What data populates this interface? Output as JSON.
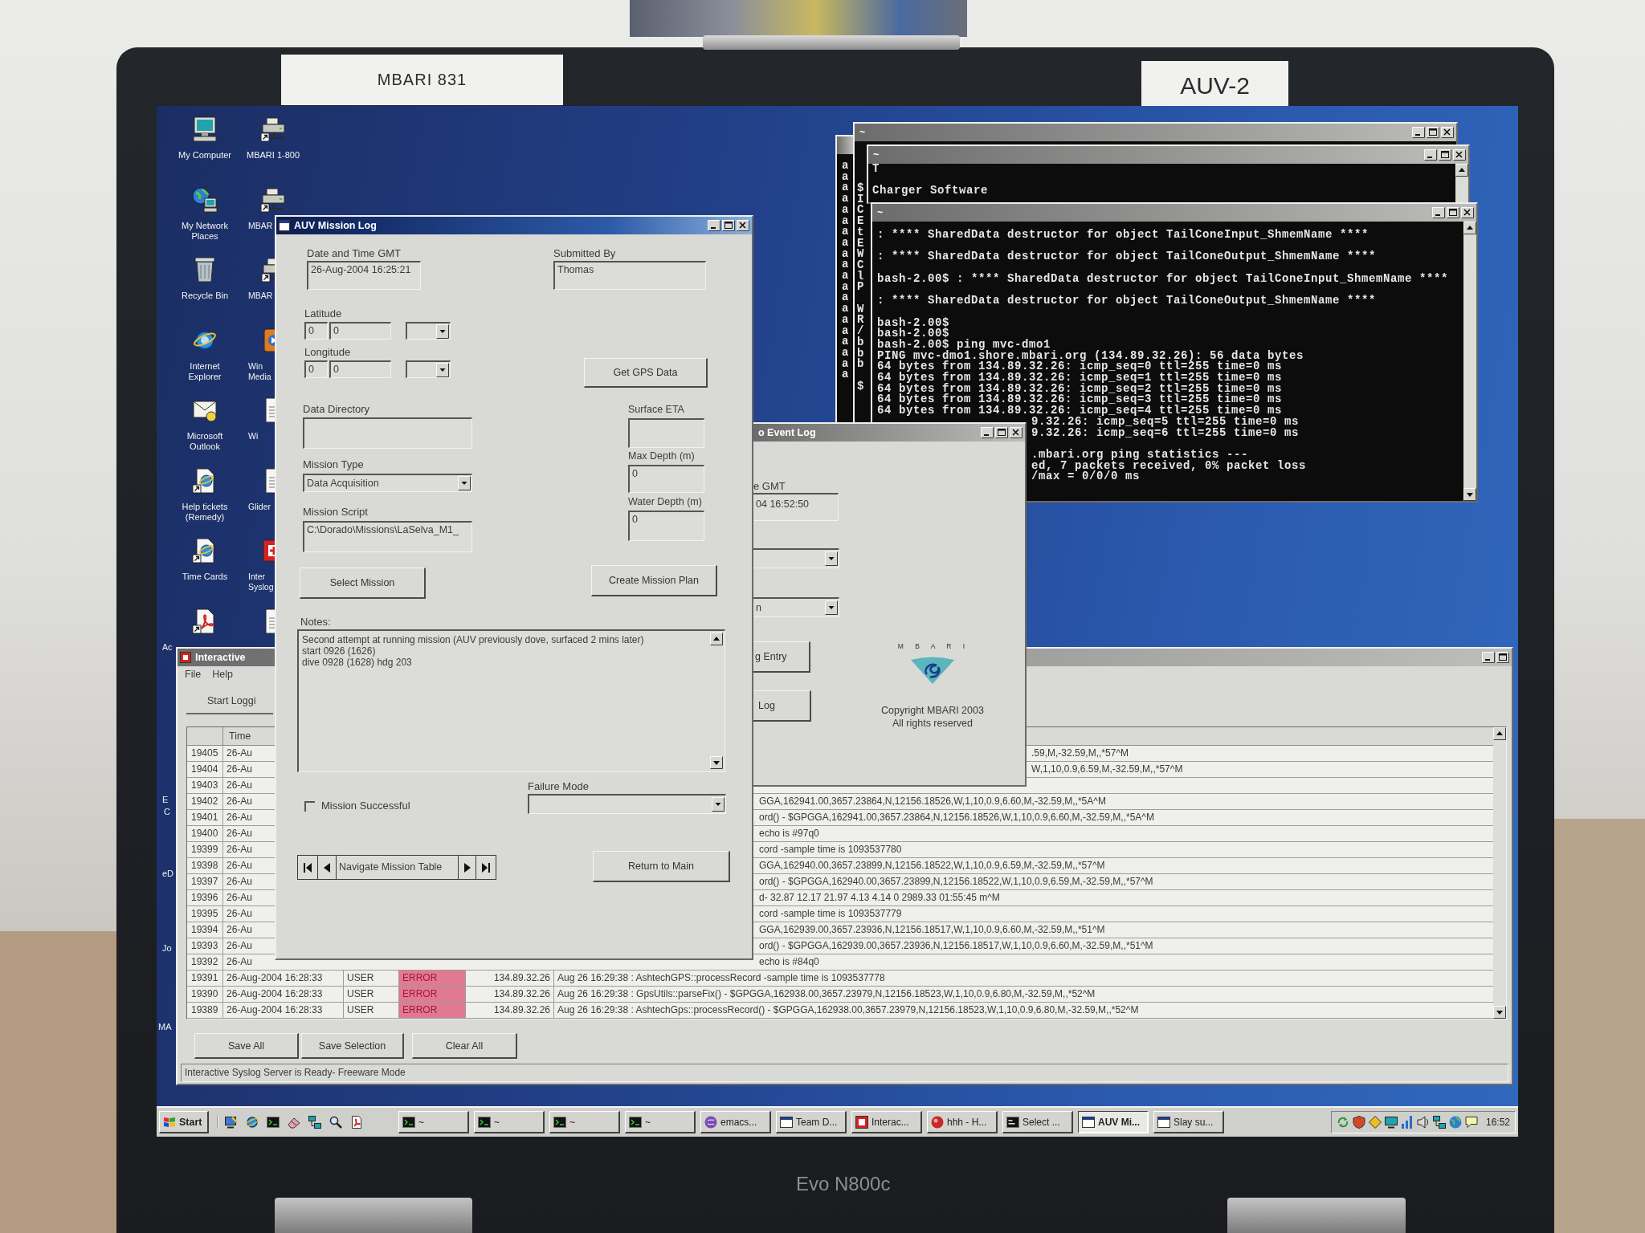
{
  "photo": {
    "stickers": [
      "MBARI 831",
      "AUV-2"
    ],
    "model_label": "Evo N800c"
  },
  "desktop_icons": [
    {
      "kind": "computer",
      "label": "My Computer"
    },
    {
      "kind": "network",
      "label": "My Network Places"
    },
    {
      "kind": "recycle",
      "label": "Recycle Bin"
    },
    {
      "kind": "browser",
      "label": "Internet Explorer"
    },
    {
      "kind": "mail",
      "label": "Microsoft Outlook"
    },
    {
      "kind": "web",
      "label": "Help tickets (Remedy)"
    },
    {
      "kind": "web",
      "label": "Time Cards"
    },
    {
      "kind": "pdf",
      "label": "Ac"
    },
    {
      "kind": "drive",
      "label": "MBARI 1-800"
    },
    {
      "kind": "drive",
      "label": "MBAR"
    },
    {
      "kind": "drive",
      "label": "MBAR"
    },
    {
      "kind": "media",
      "label": "Win Media"
    },
    {
      "kind": "document",
      "label": "Wi"
    },
    {
      "kind": "document",
      "label": "Glider"
    },
    {
      "kind": "syslog",
      "label": "Inter Syslog"
    },
    {
      "kind": "document"
    }
  ],
  "desktop_fragments": [
    "E",
    "C",
    "eD",
    "Jo",
    "MA"
  ],
  "terminals": [
    {
      "active": false,
      "blocks": [
        {
          "lines": [
            "a",
            "a",
            "a",
            "a",
            "a",
            "a",
            "a",
            "a",
            "a",
            "a",
            "a",
            "a",
            "a",
            "a",
            "a",
            "a",
            "a",
            "a",
            "a",
            "a"
          ]
        }
      ]
    },
    {
      "title": "~",
      "active": false,
      "blocks": [
        {
          "lines": [
            "$",
            "I",
            "C",
            "E",
            "t",
            "E",
            "W",
            "C",
            "l",
            "P"
          ]
        },
        {
          "lines": [
            "W",
            "R",
            "/",
            "b",
            "b",
            "b"
          ]
        },
        {
          "lines": [
            "$"
          ]
        }
      ]
    },
    {
      "title": "~",
      "active": false,
      "blocks": [
        {
          "lines": [
            "T"
          ]
        },
        {
          "lines": [
            "Charger Software"
          ]
        }
      ]
    },
    {
      "title": "~",
      "active": false,
      "blocks": [
        {
          "lines": [
            ": **** SharedData destructor for object TailConeInput_ShmemName ****"
          ]
        },
        {
          "lines": [
            ": **** SharedData destructor for object TailConeOutput_ShmemName ****"
          ]
        },
        {
          "lines": [
            "bash-2.00$ : **** SharedData destructor for object TailConeInput_ShmemName ****"
          ]
        },
        {
          "lines": [
            ": **** SharedData destructor for object TailConeOutput_ShmemName ****"
          ]
        },
        {
          "lines": [
            "bash-2.00$",
            "bash-2.00$",
            "bash-2.00$ ping mvc-dmo1",
            "PING mvc-dmo1.shore.mbari.org (134.89.32.26): 56 data bytes",
            "64 bytes from 134.89.32.26: icmp_seq=0 ttl=255 time=0 ms",
            "64 bytes from 134.89.32.26: icmp_seq=1 ttl=255 time=0 ms",
            "64 bytes from 134.89.32.26: icmp_seq=2 ttl=255 time=0 ms",
            "64 bytes from 134.89.32.26: icmp_seq=3 ttl=255 time=0 ms",
            "64 bytes from 134.89.32.26: icmp_seq=4 ttl=255 time=0 ms",
            "9.32.26: icmp_seq=5 ttl=255 time=0 ms",
            "9.32.26: icmp_seq=6 ttl=255 time=0 ms"
          ]
        },
        {
          "lines": [
            ".mbari.org ping statistics ---",
            "ed, 7 packets received, 0% packet loss",
            "/max = 0/0/0 ms"
          ]
        }
      ]
    }
  ],
  "mission_log": {
    "title": "AUV Mission Log",
    "active": true,
    "date_time": {
      "label": "Date and Time GMT",
      "value": "26-Aug-2004 16:25:21"
    },
    "submitted_by": {
      "label": "Submitted By",
      "value": "Thomas"
    },
    "latitude": {
      "label": "Latitude",
      "values": [
        "0",
        "0"
      ]
    },
    "longitude": {
      "label": "Longitude",
      "values": [
        "0",
        "0"
      ]
    },
    "get_gps_button": "Get GPS Data",
    "data_directory": {
      "label": "Data Directory"
    },
    "mission_type": {
      "label": "Mission Type",
      "value": "Data Acquisition"
    },
    "mission_script": {
      "label": "Mission Script",
      "value": "C:\\Dorado\\Missions\\LaSelva_M1_"
    },
    "surface_eta": {
      "label": "Surface ETA"
    },
    "max_depth": {
      "label": "Max Depth (m)",
      "value": "0"
    },
    "water_depth": {
      "label": "Water Depth (m)",
      "value": "0"
    },
    "select_mission_button": "Select Mission",
    "create_plan_button": "Create Mission Plan",
    "notes": {
      "label": "Notes:",
      "lines": [
        "Second attempt at running mission (AUV previously dove, surfaced 2 mins later)",
        "start 0926 (1626)",
        "dive 0928 (1628) hdg 203"
      ]
    },
    "mission_successful": {
      "label": "Mission Successful",
      "checked": false
    },
    "failure_mode": {
      "label": "Failure Mode"
    },
    "navigator": {
      "label": "Navigate Mission Table"
    },
    "return_button": "Return to Main"
  },
  "event_log": {
    "title": "o Event Log",
    "active": false,
    "time_label": "e GMT",
    "time_value": "04 16:52:50",
    "dropdowns": [
      {
        "kind": "select"
      },
      {
        "kind": "select",
        "value": "n"
      }
    ],
    "buttons": [
      "g Entry",
      "Log"
    ],
    "logo_letters": "M B A R I",
    "copyright": [
      "Copyright MBARI 2003",
      "All rights reserved"
    ]
  },
  "syslog": {
    "title": "Interactive",
    "active": false,
    "menu": [
      "File",
      "Help"
    ],
    "toolbar_button": "Start Loggi",
    "time_header": "Time",
    "rows": [
      {
        "column_1": "19405",
        "time": "26-Au",
        "kind": "behind_event_log",
        "column_6": ".59,M,-32.59,M,,*57^M"
      },
      {
        "column_1": "19404",
        "time": "26-Au",
        "kind": "behind_event_log",
        "column_6": "W,1,10,0.9,6.59,M,-32.59,M,,*57^M"
      },
      {
        "column_1": "19403",
        "time": "26-Au",
        "kind": "behind_event_log"
      },
      {
        "column_1": "19402",
        "time": "26-Au",
        "kind": "behind_mission_log",
        "column_6": "GGA,162941.00,3657.23864,N,12156.18526,W,1,10,0.9,6.60,M,-32.59,M,,*5A^M"
      },
      {
        "column_1": "19401",
        "time": "26-Au",
        "kind": "behind_mission_log",
        "column_6": "ord() - $GPGGA,162941.00,3657.23864,N,12156.18526,W,1,10,0.9,6.60,M,-32.59,M,,*5A^M"
      },
      {
        "column_1": "19400",
        "time": "26-Au",
        "kind": "behind_mission_log",
        "column_6": "echo is #97q0"
      },
      {
        "column_1": "19399",
        "time": "26-Au",
        "kind": "behind_mission_log",
        "column_6": "cord -sample time is 1093537780"
      },
      {
        "column_1": "19398",
        "time": "26-Au",
        "kind": "behind_mission_log",
        "column_6": "GGA,162940.00,3657.23899,N,12156.18522,W,1,10,0.9,6.59,M,-32.59,M,,*57^M"
      },
      {
        "column_1": "19397",
        "time": "26-Au",
        "kind": "behind_mission_log",
        "column_6": "ord() - $GPGGA,162940.00,3657.23899,N,12156.18522,W,1,10,0.9,6.59,M,-32.59,M,,*57^M"
      },
      {
        "column_1": "19396",
        "time": "26-Au",
        "kind": "behind_mission_log",
        "column_6": "d- 32.87 12.17 21.97 4.13 4.14 0 2989.33 01:55:45 m^M"
      },
      {
        "column_1": "19395",
        "time": "26-Au",
        "kind": "behind_mission_log",
        "column_6": "cord -sample time is 1093537779"
      },
      {
        "column_1": "19394",
        "time": "26-Au",
        "kind": "behind_mission_log",
        "column_6": "GGA,162939.00,3657.23936,N,12156.18517,W,1,10,0.9,6.60,M,-32.59,M,,*51^M"
      },
      {
        "column_1": "19393",
        "time": "26-Au",
        "kind": "behind_mission_log",
        "column_6": "ord() - $GPGGA,162939.00,3657.23936,N,12156.18517,W,1,10,0.9,6.60,M,-32.59,M,,*51^M"
      },
      {
        "column_1": "19392",
        "time": "26-Au",
        "kind": "behind_mission_log",
        "column_6": "echo is #84q0"
      },
      {
        "column_1": "19391",
        "time": "26-Aug-2004 16:28:33",
        "kind": "full",
        "column_3": "USER",
        "column_4": "ERROR",
        "highlighted": true,
        "column_5": "134.89.32.26",
        "column_6": "Aug 26 16:29:38 : AshtechGPS::processRecord -sample time is 1093537778"
      },
      {
        "column_1": "19390",
        "time": "26-Aug-2004 16:28:33",
        "kind": "full",
        "column_3": "USER",
        "column_4": "ERROR",
        "highlighted": true,
        "column_5": "134.89.32.26",
        "column_6": "Aug 26 16:29:38 : GpsUtils::parseFix() - $GPGGA,162938.00,3657.23979,N,12156.18523,W,1,10,0.9,6.80,M,-32.59,M,,*52^M"
      },
      {
        "column_1": "19389",
        "time": "26-Aug-2004 16:28:33",
        "kind": "full",
        "column_3": "USER",
        "column_4": "ERROR",
        "highlighted": true,
        "column_5": "134.89.32.26",
        "column_6": "Aug 26 16:29:38 : AshtechGps::processRecord() - $GPGGA,162938.00,3657.23979,N,12156.18523,W,1,10,0.9,6.80,M,-32.59,M,,*52^M"
      }
    ],
    "buttons": [
      "Save All",
      "Save Selection",
      "Clear All"
    ],
    "status": "Interactive Syslog Server is Ready- Freeware Mode"
  },
  "taskbar": {
    "start": "Start",
    "tasks": [
      {
        "label": "~",
        "kind": "cygwin",
        "selected": false
      },
      {
        "label": "~",
        "kind": "cygwin",
        "selected": false
      },
      {
        "label": "~",
        "kind": "cygwin",
        "selected": false
      },
      {
        "label": "~",
        "kind": "cygwin",
        "selected": false
      },
      {
        "label": "emacs...",
        "kind": "emacs",
        "selected": false
      },
      {
        "label": "Team D...",
        "kind": "window",
        "selected": false
      },
      {
        "label": "Interac...",
        "kind": "syslog",
        "selected": false
      },
      {
        "label": "hhh - H...",
        "kind": "ball",
        "selected": false
      },
      {
        "label": "Select ...",
        "kind": "console",
        "selected": false
      },
      {
        "label": "AUV Mi...",
        "kind": "window",
        "selected": true
      },
      {
        "label": "Slay su...",
        "kind": "window",
        "selected": false
      }
    ],
    "clock": "16:52"
  }
}
